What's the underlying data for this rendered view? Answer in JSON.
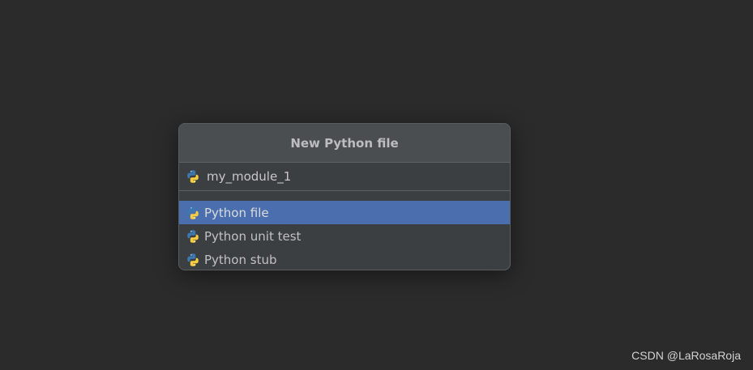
{
  "dialog": {
    "title": "New Python file",
    "name_input": {
      "value": "my_module_1",
      "icon": "python-icon"
    }
  },
  "templates": [
    {
      "label": "Python file",
      "icon": "python-icon",
      "selected": true
    },
    {
      "label": "Python unit test",
      "icon": "python-icon",
      "selected": false
    },
    {
      "label": "Python stub",
      "icon": "python-icon",
      "selected": false
    }
  ],
  "watermark": "CSDN @LaRosaRoja",
  "colors": {
    "background": "#2b2b2b",
    "popup": "#3c3f41",
    "header": "#4b4e51",
    "selection": "#4b6eaf",
    "python_blue": "#3d78b0",
    "python_yellow": "#f5cd3e"
  }
}
